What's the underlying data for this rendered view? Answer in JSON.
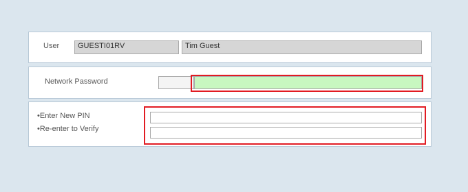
{
  "user_panel": {
    "label": "User",
    "user_id": "GUESTI01RV",
    "user_name": "Tim Guest"
  },
  "password_panel": {
    "label": "Network Password",
    "password_value": ""
  },
  "pin_panel": {
    "new_pin_label": "•Enter New PIN",
    "verify_pin_label": "•Re-enter to Verify",
    "new_pin_value": "",
    "verify_pin_value": ""
  },
  "colors": {
    "background": "#dbe6ee",
    "highlight": "#e11b22",
    "password_field": "#c8f7c0",
    "readonly_field": "#d6d6d6"
  }
}
